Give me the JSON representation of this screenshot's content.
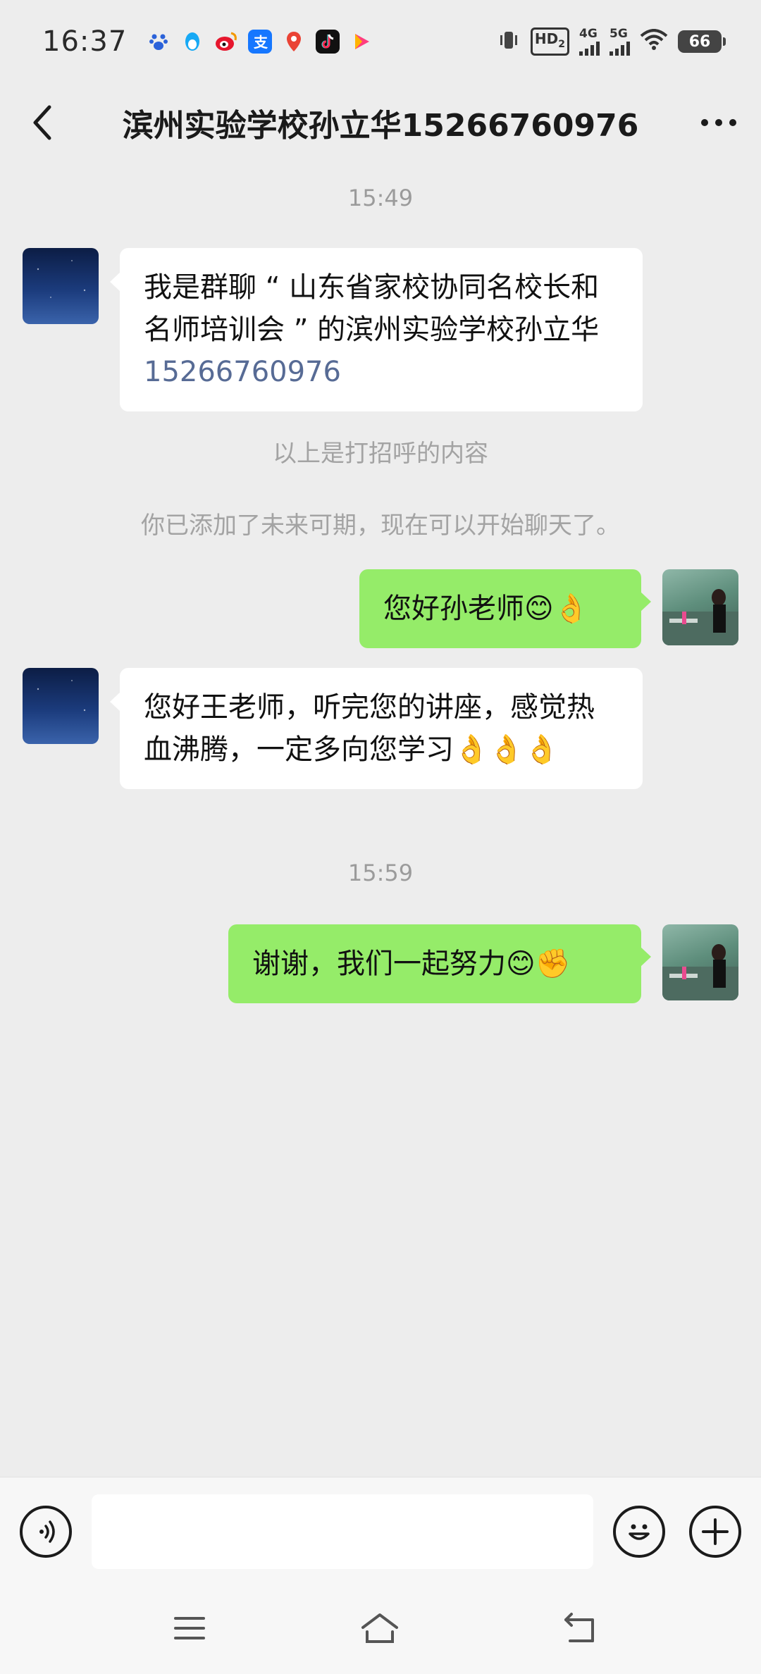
{
  "status_bar": {
    "time": "16:37",
    "notification_icons": [
      "baidu-paw-icon",
      "qq-penguin-icon",
      "weibo-icon",
      "alipay-icon",
      "map-pin-icon",
      "tiktok-icon",
      "video-play-icon"
    ],
    "hd_label": "HD",
    "hd_sub": "2",
    "sig1_label": "4G",
    "sig2_label": "5G",
    "battery": "66"
  },
  "nav": {
    "title": "滨州实验学校孙立华15266760976"
  },
  "messages": {
    "time_1": "15:49",
    "msg_1_text": "我是群聊 “ 山东省家校协同名校长和名师培训会 ” 的滨州实验学校孙立华 ",
    "msg_1_phone": "15266760976",
    "system_1": "以上是打招呼的内容",
    "system_2": "你已添加了未来可期，现在可以开始聊天了。",
    "msg_2_text": "您好孙老师😊👌",
    "msg_3_text": "您好王老师，听完您的讲座，感觉热血沸腾，一定多向您学习👌👌👌",
    "time_2": "15:59",
    "msg_4_text": "谢谢，我们一起努力😊✊"
  },
  "input_bar": {
    "value": "",
    "placeholder": ""
  },
  "colors": {
    "background": "#ededed",
    "outgoing_bubble": "#95ec69",
    "incoming_bubble": "#ffffff",
    "link": "#576b95"
  }
}
